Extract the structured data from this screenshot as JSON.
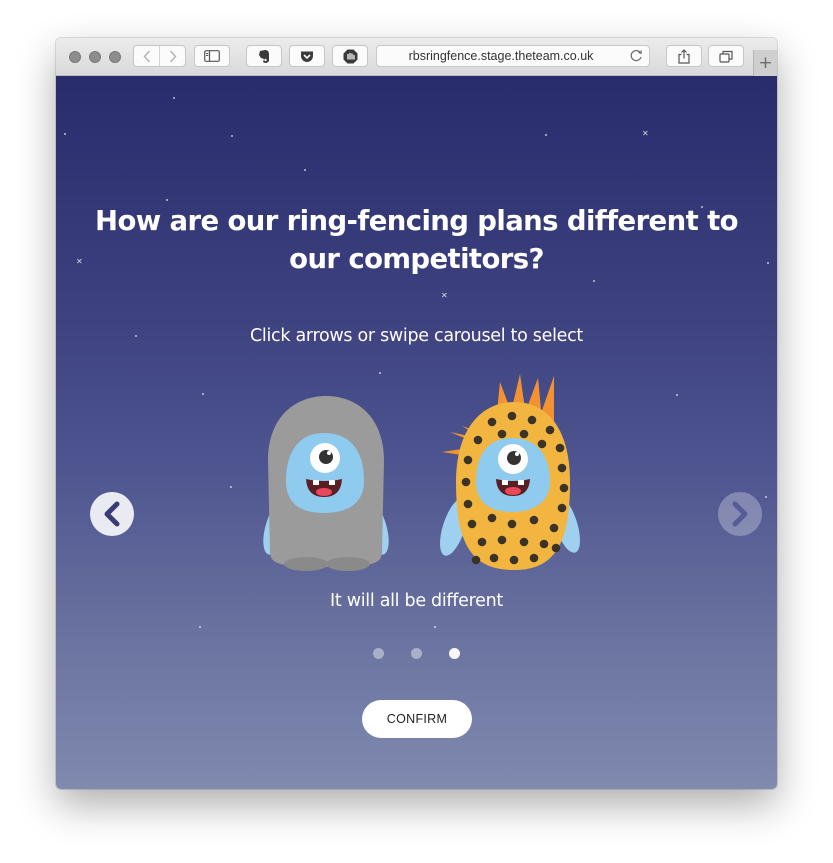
{
  "browser": {
    "url": "rbsringfence.stage.theteam.co.uk",
    "new_tab_symbol": "+"
  },
  "page": {
    "heading": "How are our ring-fencing plans different to our competitors?",
    "subheading": "Click arrows or swipe carousel to select",
    "carousel": {
      "caption": "It will all be different",
      "slide_count": 3,
      "active_index": 2,
      "prev_icon": "chevron-left-icon",
      "next_icon": "chevron-right-icon"
    },
    "confirm_label": "CONFIRM"
  },
  "colors": {
    "bg_top": "#292c6c",
    "bg_bottom": "#808aaf",
    "monster_grey": "#9b9b9b",
    "monster_yellow": "#f2b540",
    "monster_face": "#8fcbef",
    "spikes": "#f39230"
  }
}
